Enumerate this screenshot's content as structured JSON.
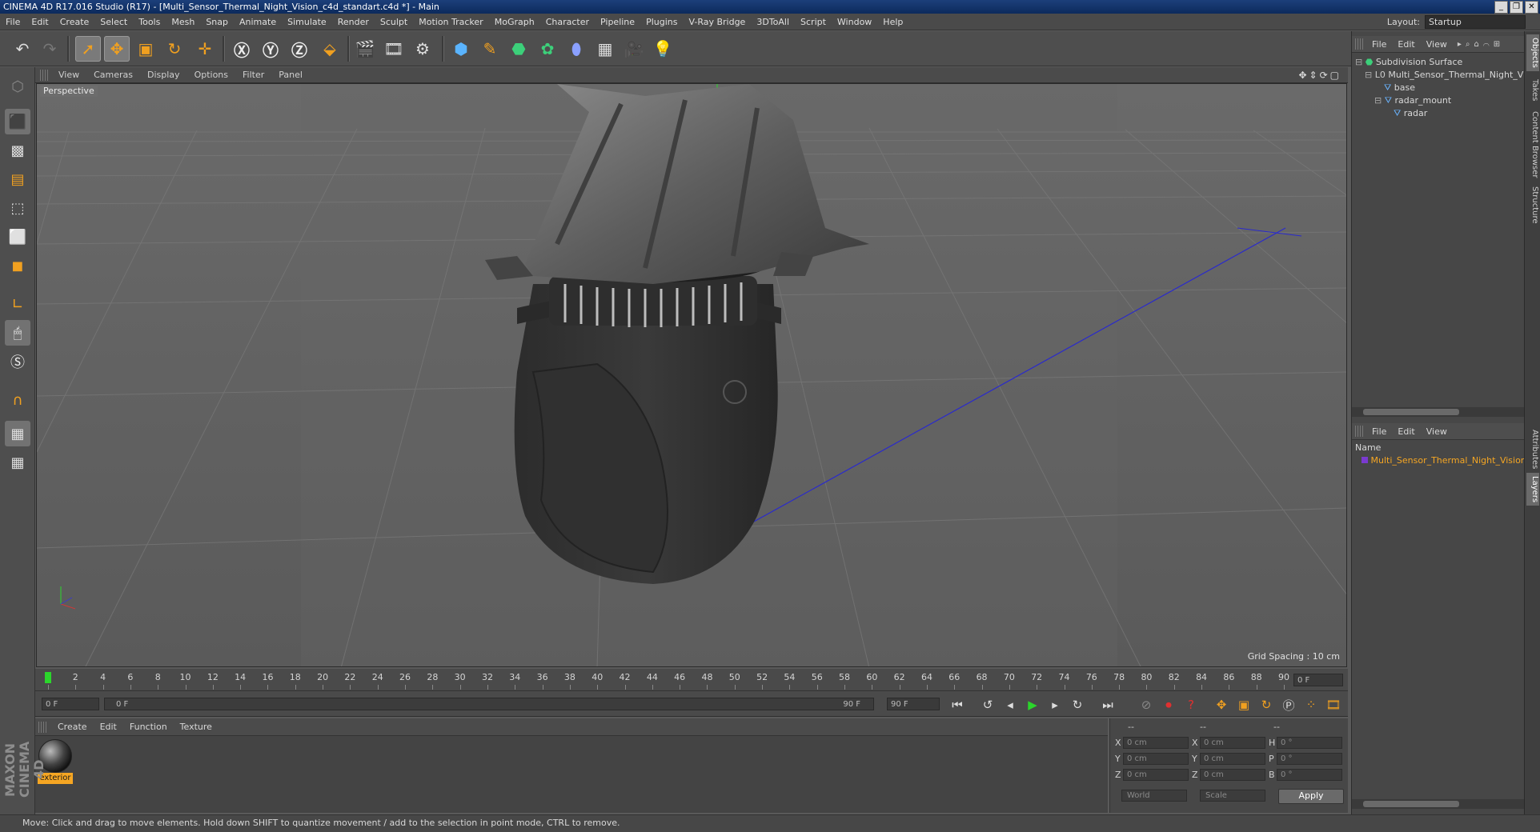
{
  "title": "CINEMA 4D R17.016 Studio (R17) - [Multi_Sensor_Thermal_Night_Vision_c4d_standart.c4d *] - Main",
  "window_buttons": [
    "_",
    "❐",
    "✕"
  ],
  "menu": [
    "File",
    "Edit",
    "Create",
    "Select",
    "Tools",
    "Mesh",
    "Snap",
    "Animate",
    "Simulate",
    "Render",
    "Sculpt",
    "Motion Tracker",
    "MoGraph",
    "Character",
    "Pipeline",
    "Plugins",
    "V-Ray Bridge",
    "3DToAll",
    "Script",
    "Window",
    "Help"
  ],
  "layout": {
    "label": "Layout:",
    "value": "Startup"
  },
  "viewport": {
    "menu": [
      "View",
      "Cameras",
      "Display",
      "Options",
      "Filter",
      "Panel"
    ],
    "label": "Perspective",
    "grid_spacing": "Grid Spacing : 10 cm"
  },
  "timeline": {
    "ticks": [
      "0",
      "2",
      "4",
      "6",
      "8",
      "10",
      "12",
      "14",
      "16",
      "18",
      "20",
      "22",
      "24",
      "26",
      "28",
      "30",
      "32",
      "34",
      "36",
      "38",
      "40",
      "42",
      "44",
      "46",
      "48",
      "50",
      "52",
      "54",
      "56",
      "58",
      "60",
      "62",
      "64",
      "66",
      "68",
      "70",
      "72",
      "74",
      "76",
      "78",
      "80",
      "82",
      "84",
      "86",
      "88",
      "90"
    ],
    "current_frame": "0 F"
  },
  "playback": {
    "start": "0 F",
    "range_start": "0 F",
    "range_end": "90 F",
    "end": "90 F"
  },
  "material_manager": {
    "menu": [
      "Create",
      "Edit",
      "Function",
      "Texture"
    ],
    "material_name": "exterior"
  },
  "coordinates": {
    "header": [
      "--",
      "--",
      "--"
    ],
    "rows": [
      {
        "l1": "X",
        "v1": "0 cm",
        "l2": "X",
        "v2": "0 cm",
        "l3": "H",
        "v3": "0 °"
      },
      {
        "l1": "Y",
        "v1": "0 cm",
        "l2": "Y",
        "v2": "0 cm",
        "l3": "P",
        "v3": "0 °"
      },
      {
        "l1": "Z",
        "v1": "0 cm",
        "l2": "Z",
        "v2": "0 cm",
        "l3": "B",
        "v3": "0 °"
      }
    ],
    "space": "World",
    "mode": "Scale",
    "apply": "Apply"
  },
  "status": "Move: Click and drag to move elements. Hold down SHIFT to quantize movement / add to the selection in point mode, CTRL to remove.",
  "object_manager": {
    "menu": [
      "File",
      "Edit",
      "View"
    ],
    "items": [
      "Subdivision Surface",
      "Multi_Sensor_Thermal_Night_Vision",
      "base",
      "radar_mount",
      "radar"
    ]
  },
  "layer_manager": {
    "menu": [
      "File",
      "Edit",
      "View"
    ],
    "column": "Name",
    "item": "Multi_Sensor_Thermal_Night_Vision"
  },
  "side_tabs_top": [
    "Objects",
    "Takes",
    "Content Browser",
    "Structure"
  ],
  "side_tabs_bottom": [
    "Attributes",
    "Layers"
  ],
  "brand": "MAXON CINEMA 4D",
  "colors": {
    "accent_orange": "#f5a623",
    "title_blue": "#0c2a5c",
    "play_green": "#2bd62b"
  }
}
